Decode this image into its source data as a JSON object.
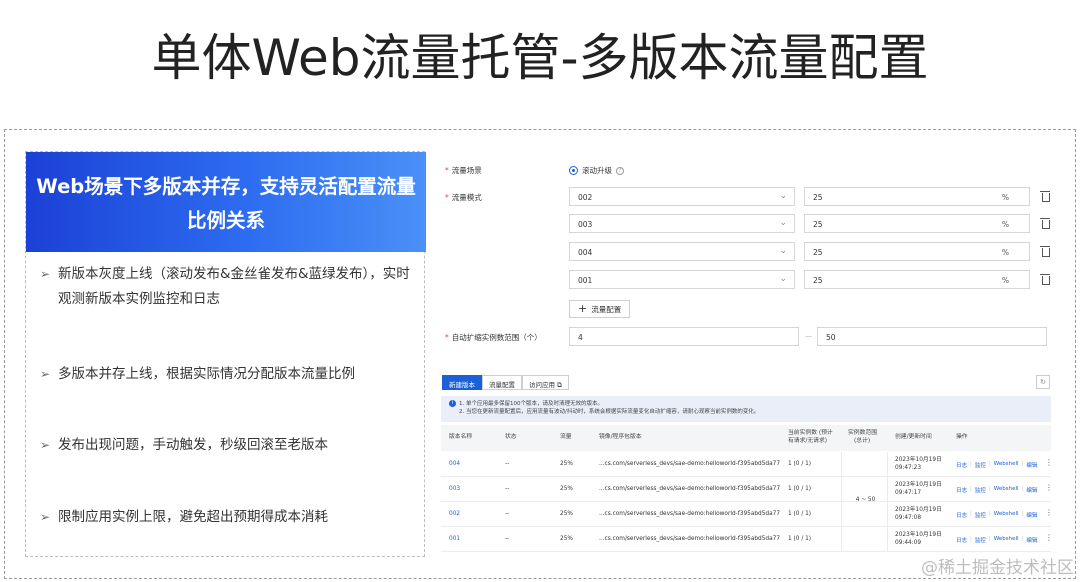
{
  "slide": {
    "title": "单体Web流量托管-多版本流量配置"
  },
  "left_panel": {
    "heading": "Web场景下多版本并存，支持灵活配置流量比例关系",
    "bullet_marker": "➢",
    "bullets": [
      "新版本灰度上线（滚动发布&金丝雀发布&蓝绿发布），实时观测新版本实例监控和日志",
      "多版本并存上线，根据实际情况分配版本流量比例",
      "发布出现问题，手动触发，秒级回滚至老版本",
      "限制应用实例上限，避免超出预期得成本消耗"
    ]
  },
  "form": {
    "scene_label": "流量场景",
    "scene_option": "滚动升级",
    "mode_label": "流量模式",
    "rules": [
      {
        "version": "002",
        "percent": "25",
        "unit": "%"
      },
      {
        "version": "003",
        "percent": "25",
        "unit": "%"
      },
      {
        "version": "004",
        "percent": "25",
        "unit": "%"
      },
      {
        "version": "001",
        "percent": "25",
        "unit": "%"
      }
    ],
    "add_button": "流量配置",
    "scale_label": "自动扩缩实例数范围（个）",
    "scale_min": "4",
    "scale_sep": "—",
    "scale_max": "50"
  },
  "toolbar": {
    "new_version": "新建版本",
    "traffic_config": "流量配置",
    "visit_app": "访问应用",
    "refresh": "↻"
  },
  "notice": {
    "line1": "1. 单个应用最多保留100个版本，请及时清理无效的版本。",
    "line2": "2. 当您在更新流量配置后，应用流量有波动/抖动时，系统会根据实际流量变化自动扩缩容，请耐心观察当前实例数的变化。"
  },
  "table": {
    "headers": {
      "version": "版本名称",
      "status": "状态",
      "traffic": "流量",
      "image": "镜像/程序包版本",
      "instances_line1": "当前实例数 (预计",
      "instances_line2": "有请求/无请求)",
      "range_line1": "实例数范围",
      "range_line2": "(总计)",
      "time": "创建/更新时间",
      "ops": "操作"
    },
    "rows": [
      {
        "version": "004",
        "status": "--",
        "traffic": "25%",
        "image": "...cs.com/serverless_devs/sae-demo:helloworld-f395abd5da77",
        "instances": "1 (0 / 1)",
        "date": "2023年10月19日",
        "time": "09:47:23"
      },
      {
        "version": "003",
        "status": "--",
        "traffic": "25%",
        "image": "...cs.com/serverless_devs/sae-demo:helloworld-f395abd5da77",
        "instances": "1 (0 / 1)",
        "date": "2023年10月19日",
        "time": "09:47:17"
      },
      {
        "version": "002",
        "status": "--",
        "traffic": "25%",
        "image": "...cs.com/serverless_devs/sae-demo:helloworld-f395abd5da77",
        "instances": "1 (0 / 1)",
        "date": "2023年10月19日",
        "time": "09:47:08"
      },
      {
        "version": "001",
        "status": "--",
        "traffic": "25%",
        "image": "...cs.com/serverless_devs/sae-demo:helloworld-f395abd5da77",
        "instances": "1 (0 / 1)",
        "date": "2023年10月19日",
        "time": "09:44:09"
      }
    ],
    "range_value": "4 ~ 50",
    "ops": {
      "log": "日志",
      "monitor": "监控",
      "webshell": "Webshell",
      "edit": "编辑"
    }
  },
  "watermark": "@稀土掘金技术社区",
  "colors": {
    "accent": "#1b5fd9",
    "header_gradient_start": "#1b41d6",
    "header_gradient_end": "#4a90f7"
  }
}
